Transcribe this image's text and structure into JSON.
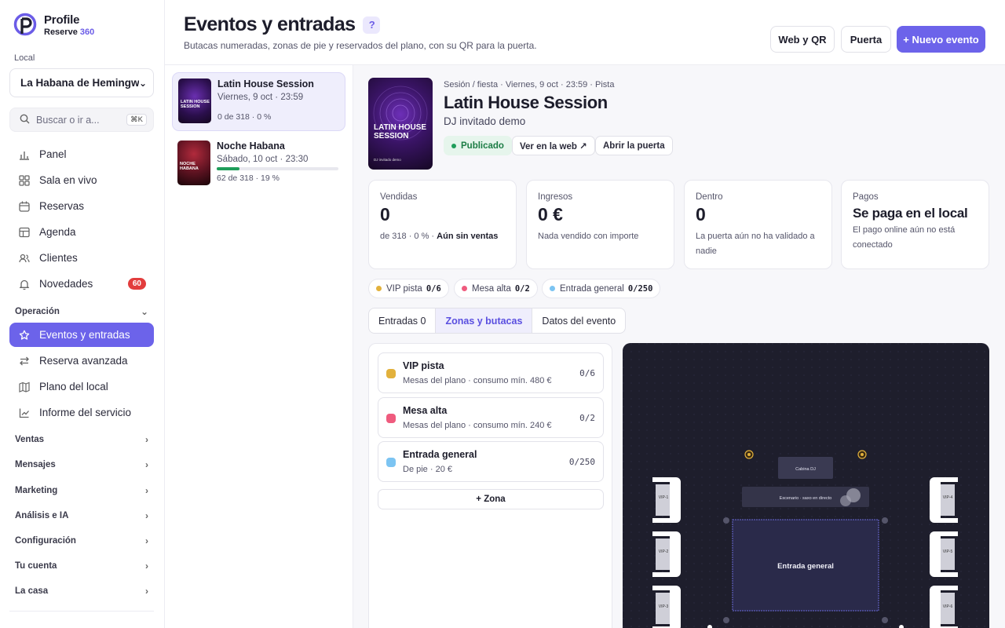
{
  "brand": {
    "name": "Profile",
    "product": "Reserve",
    "product_num": "360"
  },
  "sidebar": {
    "local_label": "Local",
    "local_value": "La Habana de Hemingway",
    "search_placeholder": "Buscar o ir a...",
    "search_shortcut": "⌘K",
    "items": [
      {
        "label": "Panel",
        "icon": "bar-chart-icon"
      },
      {
        "label": "Sala en vivo",
        "icon": "grid-icon"
      },
      {
        "label": "Reservas",
        "icon": "calendar-icon"
      },
      {
        "label": "Agenda",
        "icon": "table-icon"
      },
      {
        "label": "Clientes",
        "icon": "users-icon"
      },
      {
        "label": "Novedades",
        "icon": "bell-icon",
        "badge": "60"
      }
    ],
    "section_operacion": "Operación",
    "operacion_items": [
      {
        "label": "Eventos y entradas",
        "icon": "star-icon",
        "active": true
      },
      {
        "label": "Reserva avanzada",
        "icon": "swap-icon"
      },
      {
        "label": "Plano del local",
        "icon": "map-icon"
      },
      {
        "label": "Informe del servicio",
        "icon": "line-chart-icon"
      }
    ],
    "sections": [
      "Ventas",
      "Mensajes",
      "Marketing",
      "Análisis e IA",
      "Configuración",
      "Tu cuenta",
      "La casa"
    ]
  },
  "header": {
    "title": "Eventos y entradas",
    "help": "?",
    "subtitle": "Butacas numeradas, zonas de pie y reservados del plano, con su QR para la puerta.",
    "btn_web": "Web y QR",
    "btn_puerta": "Puerta",
    "btn_new": "+ Nuevo evento"
  },
  "events": [
    {
      "name": "Latin House Session",
      "date": "Viernes, 9 oct · 23:59",
      "meta": "0 de 318 · 0 %",
      "progress": 0,
      "thumb": "LATIN HOUSE SESSION"
    },
    {
      "name": "Noche Habana",
      "date": "Sábado, 10 oct · 23:30",
      "meta": "62 de 318 · 19 %",
      "progress": 0.19,
      "thumb": "NOCHE HABANA"
    }
  ],
  "detail": {
    "poster_title": "LATIN HOUSE SESSION",
    "poster_sub": "DJ invitado demo",
    "crumb": "Sesión / fiesta · Viernes, 9 oct · 23:59 · Pista",
    "title": "Latin House Session",
    "sub": "DJ invitado demo",
    "status": "Publicado",
    "btn_web": "Ver en la web ↗",
    "btn_door": "Abrir la puerta",
    "stats": [
      {
        "label": "Vendidas",
        "value": "0",
        "note_pre": "de 318 · 0 % · ",
        "note_bold": "Aún sin ventas"
      },
      {
        "label": "Ingresos",
        "value": "0 €",
        "note_pre": "Nada vendido con importe",
        "note_bold": ""
      },
      {
        "label": "Dentro",
        "value": "0",
        "note_pre": "La puerta aún no ha validado a nadie",
        "note_bold": ""
      },
      {
        "label": "Pagos",
        "value": "Se paga en el local",
        "note_pre": "El pago online aún no está conectado",
        "note_bold": ""
      }
    ],
    "zone_chips": [
      {
        "label": "VIP pista",
        "count": "0/6",
        "color": "#e2b13c"
      },
      {
        "label": "Mesa alta",
        "count": "0/2",
        "color": "#ef5b7e"
      },
      {
        "label": "Entrada general",
        "count": "0/250",
        "color": "#7cc4f2"
      }
    ],
    "tabs": [
      "Entradas 0",
      "Zonas y butacas",
      "Datos del evento"
    ],
    "zones": [
      {
        "name": "VIP pista",
        "desc": "Mesas del plano · consumo mín. 480 €",
        "count": "0/6",
        "color": "#e2b13c"
      },
      {
        "name": "Mesa alta",
        "desc": "Mesas del plano · consumo mín. 240 €",
        "count": "0/2",
        "color": "#ef5b7e"
      },
      {
        "name": "Entrada general",
        "desc": "De pie · 20 €",
        "count": "0/250",
        "color": "#7cc4f2"
      }
    ],
    "add_zone": "+ Zona",
    "floor": {
      "dj_booth": "Cabina DJ",
      "stage": "Escenario · saxo en directo",
      "general": "Entrada general",
      "vip_left": [
        "VIP-1",
        "VIP-2",
        "VIP-3"
      ],
      "vip_right": [
        "VIP-4",
        "VIP-5",
        "VIP-6"
      ]
    }
  }
}
